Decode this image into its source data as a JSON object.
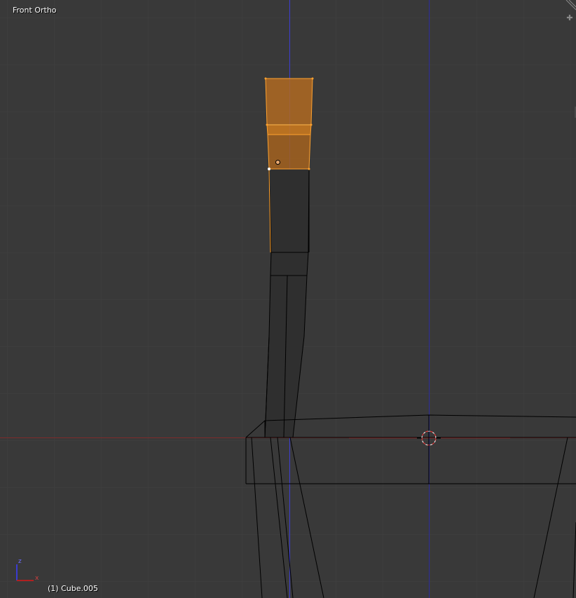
{
  "viewport": {
    "view_name": "Front Ortho",
    "object_info": "(1) Cube.005"
  },
  "gizmo": {
    "z_label": "z",
    "x_label": "x"
  },
  "colors": {
    "background": "#393939",
    "grid": "#414141",
    "x_axis": "#9a2a2a",
    "z_axis": "#3b3bd0",
    "wire": "#000000",
    "selected": "#ffa22f",
    "selected_fill": "#d9771e",
    "cursor": "#ff3333"
  },
  "icons": {
    "corner_widget": "plus-icon",
    "cursor_3d": "3d-cursor-icon"
  }
}
